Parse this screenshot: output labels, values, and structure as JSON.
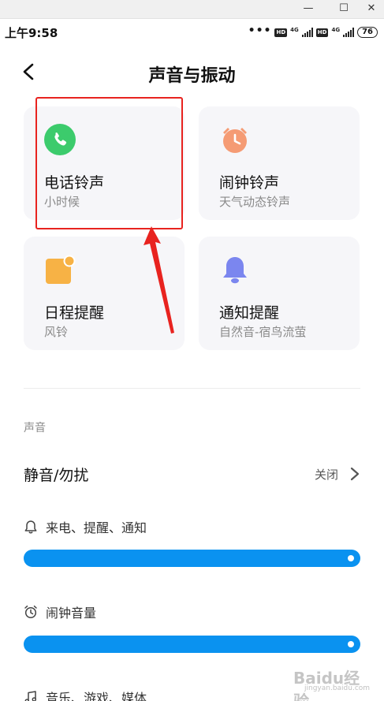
{
  "window": {
    "minimize": "—",
    "maximize": "☐",
    "close": "✕"
  },
  "status_bar": {
    "time": "上午9:58",
    "dots": "•••",
    "hd1": "HD",
    "net1": "4G",
    "hd2": "HD",
    "net2": "4G",
    "battery": "76"
  },
  "header": {
    "title": "声音与振动",
    "back_icon": "chevron-left-icon"
  },
  "cards": [
    {
      "title": "电话铃声",
      "subtitle": "小时候",
      "icon": "phone-icon",
      "color": "#3ccb6c"
    },
    {
      "title": "闹钟铃声",
      "subtitle": "天气动态铃声",
      "icon": "alarm-clock-icon",
      "color": "#f59b74"
    },
    {
      "title": "日程提醒",
      "subtitle": "风铃",
      "icon": "calendar-icon",
      "color": "#f7b245"
    },
    {
      "title": "通知提醒",
      "subtitle": "自然音-宿鸟流萤",
      "icon": "bell-icon",
      "color": "#7b86ef"
    }
  ],
  "sound_section": {
    "label": "声音",
    "mute_row": {
      "label": "静音/勿扰",
      "value": "关闭"
    },
    "ring_volume": {
      "label": "来电、提醒、通知",
      "level": 1.0
    },
    "alarm_volume": {
      "label": "闹钟音量",
      "level": 1.0
    },
    "media_volume": {
      "label": "音乐、游戏、媒体"
    }
  },
  "annotation": {
    "highlight_color": "#e8231f"
  },
  "watermark": {
    "text": "Baidu经验",
    "sub": "jingyan.baidu.com"
  }
}
